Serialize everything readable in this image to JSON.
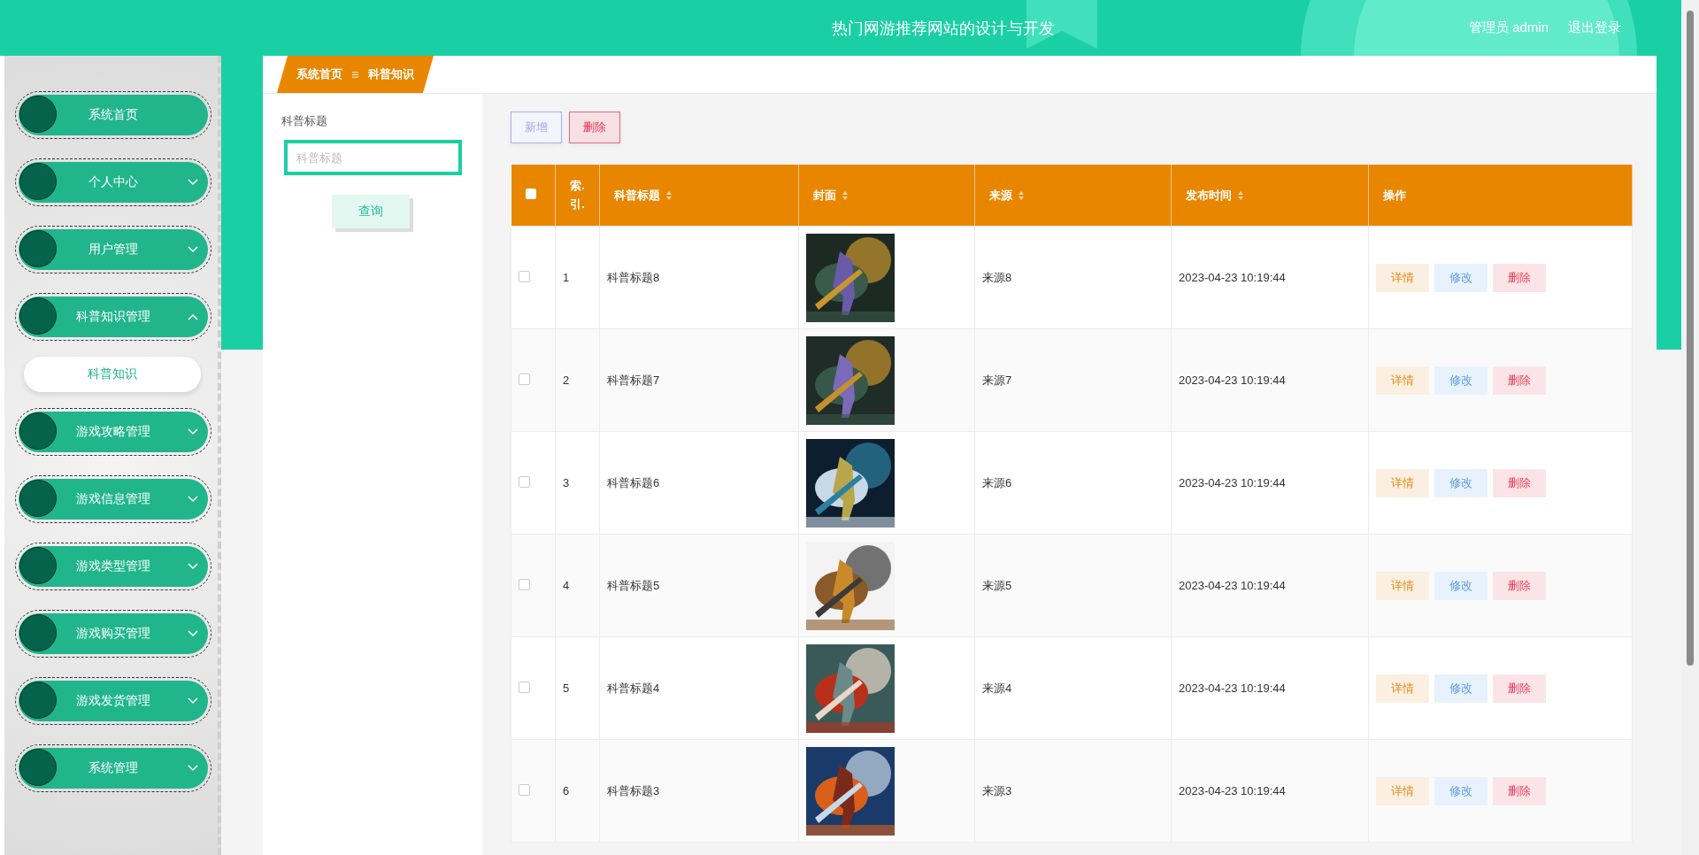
{
  "header": {
    "title": "热门网游推荐网站的设计与开发",
    "user": "管理员 admin",
    "logout": "退出登录"
  },
  "sidebar": {
    "items": [
      {
        "label": "系统首页"
      },
      {
        "label": "个人中心",
        "expanded": false
      },
      {
        "label": "用户管理",
        "expanded": false
      },
      {
        "label": "科普知识管理",
        "expanded": true,
        "children": [
          {
            "label": "科普知识",
            "selected": true
          }
        ]
      },
      {
        "label": "游戏攻略管理",
        "expanded": false
      },
      {
        "label": "游戏信息管理",
        "expanded": false
      },
      {
        "label": "游戏类型管理",
        "expanded": false
      },
      {
        "label": "游戏购买管理",
        "expanded": false
      },
      {
        "label": "游戏发货管理",
        "expanded": false
      },
      {
        "label": "系统管理",
        "expanded": false
      }
    ]
  },
  "breadcrumb": [
    "系统首页",
    "科普知识"
  ],
  "search": {
    "label": "科普标题",
    "placeholder": "科普标题",
    "button": "查询"
  },
  "toolbar": [
    {
      "label": "新增",
      "kind": "add"
    },
    {
      "label": "删除",
      "kind": "delete"
    }
  ],
  "table": {
    "select_all": {
      "checked": false
    },
    "columns": [
      {
        "label": "索.引.",
        "sortable": false
      },
      {
        "label": "科普标题",
        "sortable": true
      },
      {
        "label": "封面",
        "sortable": true
      },
      {
        "label": "来源",
        "sortable": true
      },
      {
        "label": "发布时间",
        "sortable": true
      },
      {
        "label": "操作",
        "sortable": false
      }
    ],
    "rows": [
      {
        "checked": false,
        "index": "1",
        "title": "科普标题8",
        "source": "来源8",
        "time": "2023-04-23 10:19:44",
        "actions": [
          {
            "label": "详情",
            "kind": "detail"
          },
          {
            "label": "修改",
            "kind": "edit"
          },
          {
            "label": "删除",
            "kind": "delete"
          }
        ]
      },
      {
        "checked": false,
        "index": "2",
        "title": "科普标题7",
        "source": "来源7",
        "time": "2023-04-23 10:19:44",
        "actions": [
          {
            "label": "详情",
            "kind": "detail"
          },
          {
            "label": "修改",
            "kind": "edit"
          },
          {
            "label": "删除",
            "kind": "delete"
          }
        ]
      },
      {
        "checked": false,
        "index": "3",
        "title": "科普标题6",
        "source": "来源6",
        "time": "2023-04-23 10:19:44",
        "actions": [
          {
            "label": "详情",
            "kind": "detail"
          },
          {
            "label": "修改",
            "kind": "edit"
          },
          {
            "label": "删除",
            "kind": "delete"
          }
        ]
      },
      {
        "checked": false,
        "index": "4",
        "title": "科普标题5",
        "source": "来源5",
        "time": "2023-04-23 10:19:44",
        "actions": [
          {
            "label": "详情",
            "kind": "detail"
          },
          {
            "label": "修改",
            "kind": "edit"
          },
          {
            "label": "删除",
            "kind": "delete"
          }
        ]
      },
      {
        "checked": false,
        "index": "5",
        "title": "科普标题4",
        "source": "来源4",
        "time": "2023-04-23 10:19:44",
        "actions": [
          {
            "label": "详情",
            "kind": "detail"
          },
          {
            "label": "修改",
            "kind": "edit"
          },
          {
            "label": "删除",
            "kind": "delete"
          }
        ]
      },
      {
        "checked": false,
        "index": "6",
        "title": "科普标题3",
        "source": "来源3",
        "time": "2023-04-23 10:19:44",
        "actions": [
          {
            "label": "详情",
            "kind": "detail"
          },
          {
            "label": "修改",
            "kind": "edit"
          },
          {
            "label": "删除",
            "kind": "delete"
          }
        ]
      }
    ]
  }
}
